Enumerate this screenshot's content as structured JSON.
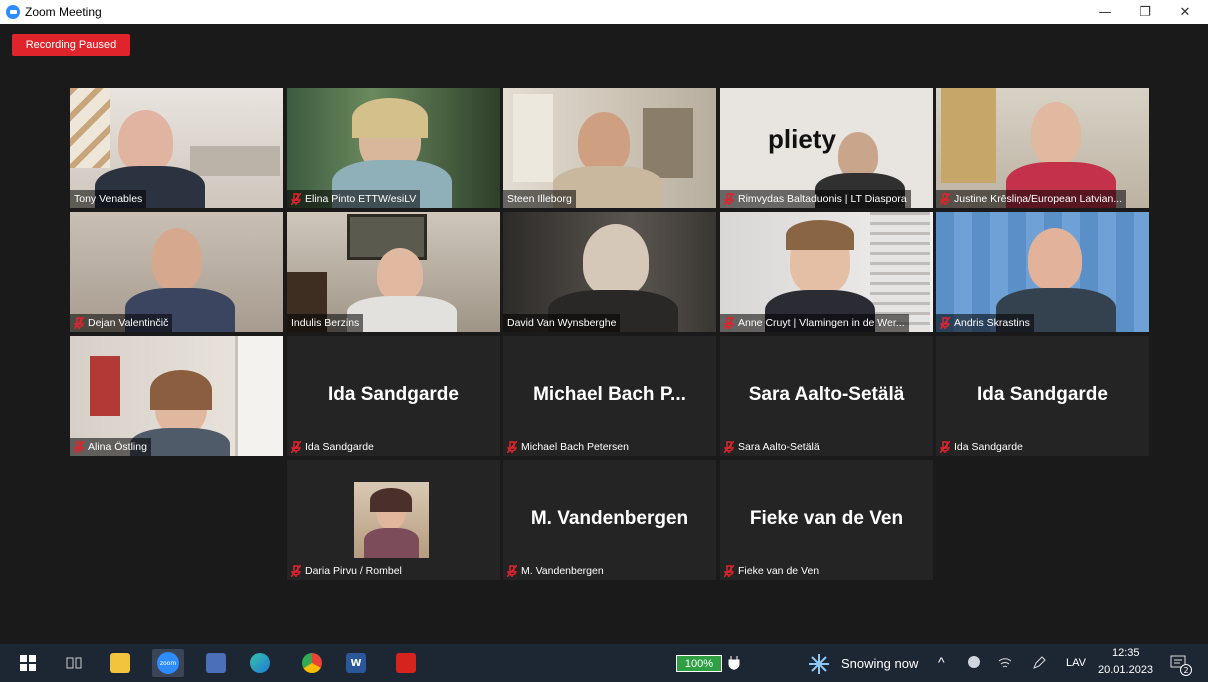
{
  "window": {
    "title": "Zoom Meeting",
    "minimize": "—",
    "restore": "❐",
    "close": "✕"
  },
  "recording": {
    "label": "Recording Paused"
  },
  "tiles": [
    {
      "name": "Tony Venables",
      "muted": false
    },
    {
      "name": "Elina Pinto ETTW/esiLV",
      "muted": true
    },
    {
      "name": "Steen Illeborg",
      "muted": false,
      "active": true
    },
    {
      "name": "Rimvydas Baltaduonis | LT Diaspora",
      "muted": true,
      "logo": "pliety"
    },
    {
      "name": "Justine Krēsliņa/European Latvian...",
      "muted": true
    },
    {
      "name": "Dejan Valentinčič",
      "muted": true
    },
    {
      "name": "Indulis Berzins",
      "muted": false
    },
    {
      "name": "David Van Wynsberghe",
      "muted": false
    },
    {
      "name": "Anne Cruyt | Vlamingen in de Wer...",
      "muted": true
    },
    {
      "name": "Andris Skrastins",
      "muted": true
    },
    {
      "name": "Alina Östling",
      "muted": true
    },
    {
      "name": "Ida Sandgarde",
      "muted": true,
      "big": "Ida Sandgarde"
    },
    {
      "name": "Michael Bach Petersen",
      "muted": true,
      "big": "Michael Bach P..."
    },
    {
      "name": "Sara Aalto-Setälä",
      "muted": true,
      "big": "Sara Aalto-Setälä"
    },
    {
      "name": "Ida Sandgarde",
      "muted": true,
      "big": "Ida Sandgarde"
    },
    {
      "name": "Daria Pirvu / Rombel",
      "muted": true
    },
    {
      "name": "M. Vandenbergen",
      "muted": true,
      "big": "M. Vandenbergen"
    },
    {
      "name": "Fieke van de Ven",
      "muted": true,
      "big": "Fieke van de Ven"
    }
  ],
  "taskbar": {
    "battery": "100%",
    "weather": "Snowing now",
    "lang": "LAV",
    "time": "12:35",
    "date": "20.01.2023",
    "notifications": "2",
    "zoom_label": "zoom",
    "word_label": "W"
  },
  "colors": {
    "recording": "#e0242b",
    "active_border": "#c8e04a",
    "muted_mic": "#e0242b",
    "taskbar": "#1d2733"
  }
}
